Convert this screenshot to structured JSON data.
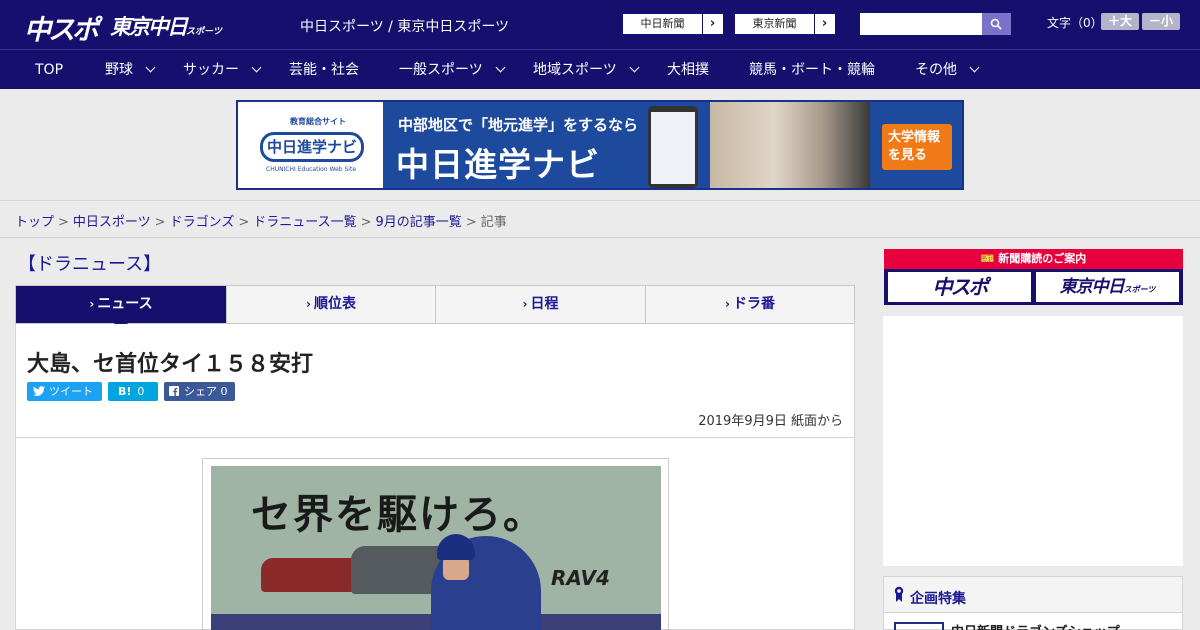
{
  "header": {
    "logo_main": "中スポ",
    "logo_tokyo": "東京中日",
    "logo_tokyo_small": "スポーツ",
    "site_name": "中日スポーツ / 東京中日スポーツ",
    "paper_links": [
      "中日新聞",
      "東京新聞"
    ],
    "search": {
      "placeholder": ""
    },
    "font_size_label": "文字（0）",
    "font_larger": "＋大",
    "font_smaller": "－小"
  },
  "nav": {
    "items": [
      {
        "label": "TOP",
        "dropdown": false
      },
      {
        "label": "野球",
        "dropdown": true
      },
      {
        "label": "サッカー",
        "dropdown": true
      },
      {
        "label": "芸能・社会",
        "dropdown": false
      },
      {
        "label": "一般スポーツ",
        "dropdown": true
      },
      {
        "label": "地域スポーツ",
        "dropdown": true
      },
      {
        "label": "大相撲",
        "dropdown": false
      },
      {
        "label": "競馬・ボート・競輪",
        "dropdown": false
      },
      {
        "label": "その他",
        "dropdown": true
      }
    ]
  },
  "banner": {
    "tag": "教育総合サイト",
    "logo": "中日進学ナビ",
    "logo_sub": "CHUNICHI Education Web Site",
    "line1": "中部地区で「地元進学」をするなら",
    "line2": "中日進学ナビ",
    "cta": "大学情報を見る"
  },
  "breadcrumb": {
    "items": [
      "トップ",
      "中日スポーツ",
      "ドラゴンズ",
      "ドラニュース一覧",
      "9月の記事一覧"
    ],
    "current": "記事",
    "separator": ">"
  },
  "section": {
    "title": "【ドラニュース】"
  },
  "tabs": [
    {
      "label": "ニュース",
      "active": true
    },
    {
      "label": "順位表",
      "active": false
    },
    {
      "label": "日程",
      "active": false
    },
    {
      "label": "ドラ番",
      "active": false
    }
  ],
  "article": {
    "headline": "大島、セ首位タイ１５８安打",
    "share": {
      "tweet": "ツイート",
      "hatena": "0",
      "facebook": "シェア 0"
    },
    "date": "2019年9月9日 紙面から",
    "photo_board_text": "セ界を駆けろ。",
    "photo_car_text": "RAV4"
  },
  "sidebar": {
    "subscribe_head": "新聞購読のご案内",
    "subscribe_items": [
      "中スポ",
      "東京中日"
    ],
    "subscribe_small": "スポーツ",
    "feature_title": "企画特集",
    "feature_item": "中日新聞ドラゴンズショップ"
  },
  "colors": {
    "navy": "#170f6e",
    "link": "#1c1896",
    "tweet": "#1da1f2",
    "hatena": "#00a4de",
    "facebook": "#3b5998",
    "subscribe_red": "#e8003c"
  }
}
